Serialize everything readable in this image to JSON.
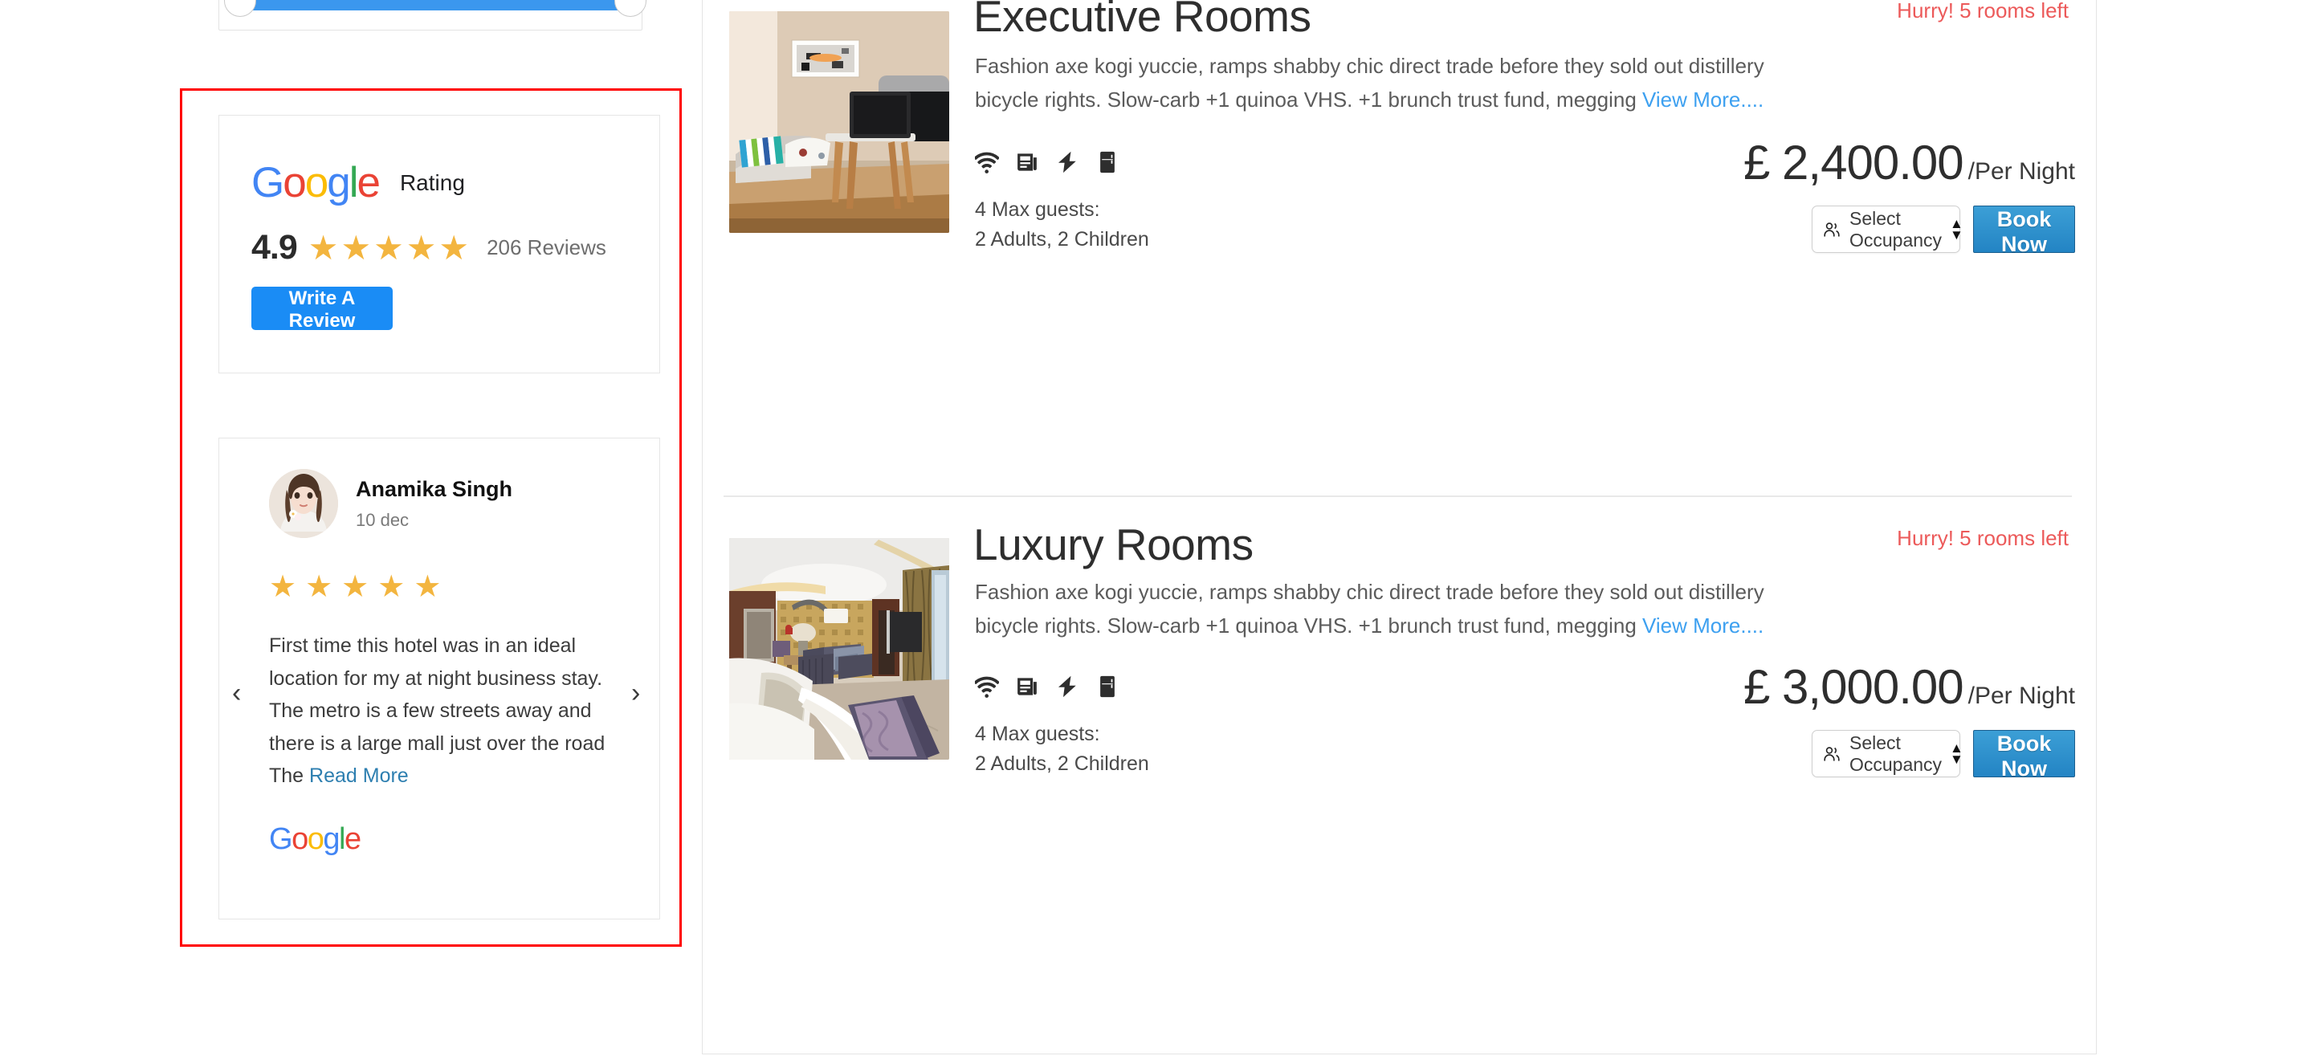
{
  "filters": {
    "price_slider": {
      "name": "price-range-slider",
      "fill_color": "#3b97ee"
    }
  },
  "google_rating_card": {
    "logo_text": "Google",
    "rating_label": "Rating",
    "score": "4.9",
    "stars": 5,
    "reviews_count": "206 Reviews",
    "write_review_label": "Write A Review",
    "star_color": "#F3B53F",
    "button_color": "#1a8cf5"
  },
  "review_card": {
    "reviewer_name": "Anamika Singh",
    "date": "10 dec",
    "stars": 5,
    "text_before_link": "First time this hotel was in an ideal location for my at night business stay. The metro is a few streets away and there is a large mall just over the road The ",
    "read_more_label": "Read More",
    "source_logo_text": "Google",
    "prev_arrow": "‹",
    "next_arrow": "›"
  },
  "rooms": [
    {
      "title": "Executive Rooms",
      "availability": "Hurry! 5 rooms left",
      "description": "Fashion axe kogi yuccie, ramps shabby chic direct trade before they sold out distillery bicycle rights. Slow-carb +1 quinoa VHS. +1 brunch trust fund, megging ",
      "view_more_label": "View More....",
      "amenities": [
        "wifi-icon",
        "newspaper-icon",
        "lightning-bolt-icon",
        "refrigerator-icon"
      ],
      "max_guests_line1": "4 Max guests:",
      "max_guests_line2": "2 Adults, 2 Children",
      "price": "£ 2,400.00",
      "price_unit": "/Per Night",
      "occupancy_label": "Select Occupancy",
      "book_label": "Book Now",
      "photo_alt": "executive room interior with sofa, pillows and laptop on desk"
    },
    {
      "title": "Luxury Rooms",
      "availability": "Hurry! 5 rooms left",
      "description": "Fashion axe kogi yuccie, ramps shabby chic direct trade before they sold out distillery bicycle rights. Slow-carb +1 quinoa VHS. +1 brunch trust fund, megging ",
      "view_more_label": "View More....",
      "amenities": [
        "wifi-icon",
        "newspaper-icon",
        "lightning-bolt-icon",
        "refrigerator-icon"
      ],
      "max_guests_line1": "4 Max guests:",
      "max_guests_line2": "2 Adults, 2 Children",
      "price": "£ 3,000.00",
      "price_unit": "/Per Night",
      "occupancy_label": "Select Occupancy",
      "book_label": "Book Now",
      "photo_alt": "luxury suite with king bed, lounge area and city window"
    }
  ],
  "colors": {
    "accent_blue": "#3da0f0",
    "alert_red": "#ec5a5a",
    "highlight_box": "#ff0000",
    "book_button": "#2384c4"
  }
}
